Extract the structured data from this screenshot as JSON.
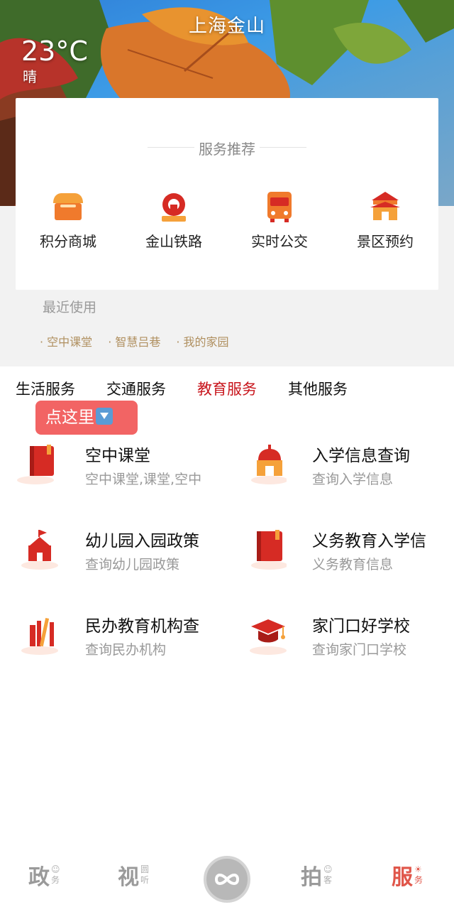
{
  "header": {
    "city": "上海金山",
    "temperature": "23°C",
    "weather": "晴"
  },
  "recommend": {
    "title": "服务推荐",
    "items": [
      {
        "label": "积分商城",
        "icon": "shop-icon"
      },
      {
        "label": "金山铁路",
        "icon": "railway-icon"
      },
      {
        "label": "实时公交",
        "icon": "bus-icon"
      },
      {
        "label": "景区预约",
        "icon": "gate-icon"
      }
    ]
  },
  "recent": {
    "title": "最近使用",
    "items": [
      "空中课堂",
      "智慧吕巷",
      "我的家园"
    ]
  },
  "tabs": [
    {
      "label": "生活服务",
      "active": false
    },
    {
      "label": "交通服务",
      "active": false
    },
    {
      "label": "教育服务",
      "active": true
    },
    {
      "label": "其他服务",
      "active": false
    }
  ],
  "hint": {
    "label": "点这里",
    "icon": "down-arrow-icon"
  },
  "services": [
    {
      "name": "空中课堂",
      "desc": "空中课堂,课堂,空中",
      "icon": "book-icon"
    },
    {
      "name": "入学信息查询",
      "desc": "查询入学信息",
      "icon": "building-icon"
    },
    {
      "name": "幼儿园入园政策",
      "desc": "查询幼儿园政策",
      "icon": "school-icon"
    },
    {
      "name": "义务教育入学信",
      "desc": "义务教育信息",
      "icon": "book-icon"
    },
    {
      "name": "民办教育机构查",
      "desc": "查询民办机构",
      "icon": "books-icon"
    },
    {
      "name": "家门口好学校",
      "desc": "查询家门口学校",
      "icon": "graduation-cap-icon"
    }
  ],
  "bottom_nav": [
    {
      "big": "政",
      "small": [
        "☺",
        "务"
      ],
      "active": false
    },
    {
      "big": "视",
      "small": [
        "圆",
        "听"
      ],
      "active": false
    },
    {
      "big": "拍",
      "small": [
        "☺",
        "客"
      ],
      "active": false
    },
    {
      "big": "服",
      "small": [
        "☀",
        "务"
      ],
      "active": true
    }
  ],
  "colors": {
    "accent": "#c8161d",
    "hint_bg": "#f26464",
    "recent_text": "#b09060"
  }
}
